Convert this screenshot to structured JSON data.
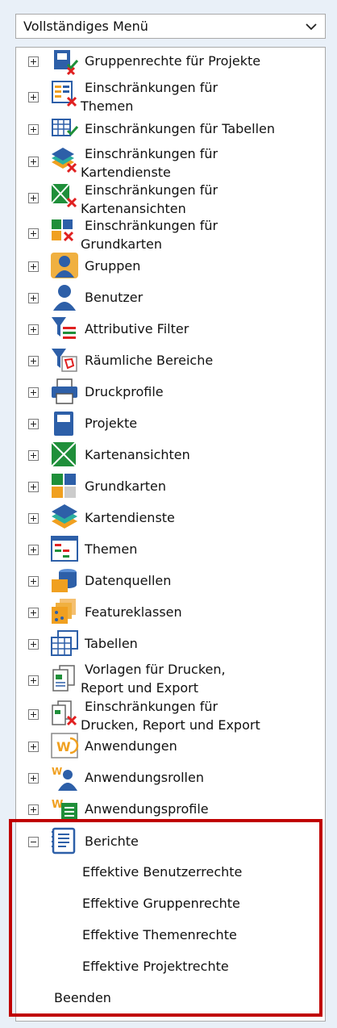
{
  "menu_select": {
    "value": "Vollständiges Menü",
    "icon": "chevron-down-icon"
  },
  "items": [
    {
      "id": "gruppenrechte-projekte",
      "lines": [
        "Gruppenrechte für Projekte"
      ],
      "icon": "project-permissions-icon"
    },
    {
      "id": "einschraenkungen-themen",
      "lines": [
        "Einschränkungen für",
        "Themen"
      ],
      "icon": "layer-restrictions-icon"
    },
    {
      "id": "einschraenkungen-tabellen",
      "lines": [
        "Einschränkungen für Tabellen"
      ],
      "icon": "table-restrictions-icon"
    },
    {
      "id": "einschraenkungen-kartendienste",
      "lines": [
        "Einschränkungen für",
        "Kartendienste"
      ],
      "icon": "map-service-restrictions-icon"
    },
    {
      "id": "einschraenkungen-kartenansichten",
      "lines": [
        "Einschränkungen für",
        "Kartenansichten"
      ],
      "icon": "map-view-restrictions-icon"
    },
    {
      "id": "einschraenkungen-grundkarten",
      "lines": [
        "Einschränkungen für",
        "Grundkarten"
      ],
      "icon": "basemap-restrictions-icon"
    },
    {
      "id": "gruppen",
      "lines": [
        "Gruppen"
      ],
      "icon": "groups-icon"
    },
    {
      "id": "benutzer",
      "lines": [
        "Benutzer"
      ],
      "icon": "user-icon"
    },
    {
      "id": "attributive-filter",
      "lines": [
        "Attributive Filter"
      ],
      "icon": "attribute-filter-icon"
    },
    {
      "id": "raeumliche-bereiche",
      "lines": [
        "Räumliche Bereiche"
      ],
      "icon": "spatial-filter-icon"
    },
    {
      "id": "druckprofile",
      "lines": [
        "Druckprofile"
      ],
      "icon": "printer-icon"
    },
    {
      "id": "projekte",
      "lines": [
        "Projekte"
      ],
      "icon": "project-icon"
    },
    {
      "id": "kartenansichten",
      "lines": [
        "Kartenansichten"
      ],
      "icon": "map-view-icon"
    },
    {
      "id": "grundkarten",
      "lines": [
        "Grundkarten"
      ],
      "icon": "basemap-icon"
    },
    {
      "id": "kartendienste",
      "lines": [
        "Kartendienste"
      ],
      "icon": "map-service-icon"
    },
    {
      "id": "themen",
      "lines": [
        "Themen"
      ],
      "icon": "layers-icon"
    },
    {
      "id": "datenquellen",
      "lines": [
        "Datenquellen"
      ],
      "icon": "database-icon"
    },
    {
      "id": "featureklassen",
      "lines": [
        "Featureklassen"
      ],
      "icon": "feature-class-icon"
    },
    {
      "id": "tabellen",
      "lines": [
        "Tabellen"
      ],
      "icon": "table-icon"
    },
    {
      "id": "vorlagen",
      "lines": [
        "Vorlagen für Drucken,",
        "Report und Export"
      ],
      "icon": "templates-icon"
    },
    {
      "id": "einschraenkungen-drucken",
      "lines": [
        "Einschränkungen für",
        "Drucken, Report und Export"
      ],
      "icon": "template-restrictions-icon"
    },
    {
      "id": "anwendungen",
      "lines": [
        "Anwendungen"
      ],
      "icon": "application-icon"
    },
    {
      "id": "anwendungsrollen",
      "lines": [
        "Anwendungsrollen"
      ],
      "icon": "application-roles-icon"
    },
    {
      "id": "anwendungsprofile",
      "lines": [
        "Anwendungsprofile"
      ],
      "icon": "application-profiles-icon"
    },
    {
      "id": "berichte",
      "lines": [
        "Berichte"
      ],
      "icon": "reports-icon",
      "expanded": true
    }
  ],
  "reports": [
    "Effektive Benutzerrechte",
    "Effektive Gruppenrechte",
    "Effektive Themenrechte",
    "Effektive Projektrechte"
  ],
  "exit_label": "Beenden",
  "colors": {
    "highlight": "#c00000",
    "icon_blue": "#2d5fa8",
    "check_green": "#1f8f3a",
    "cross_red": "#e02020"
  }
}
